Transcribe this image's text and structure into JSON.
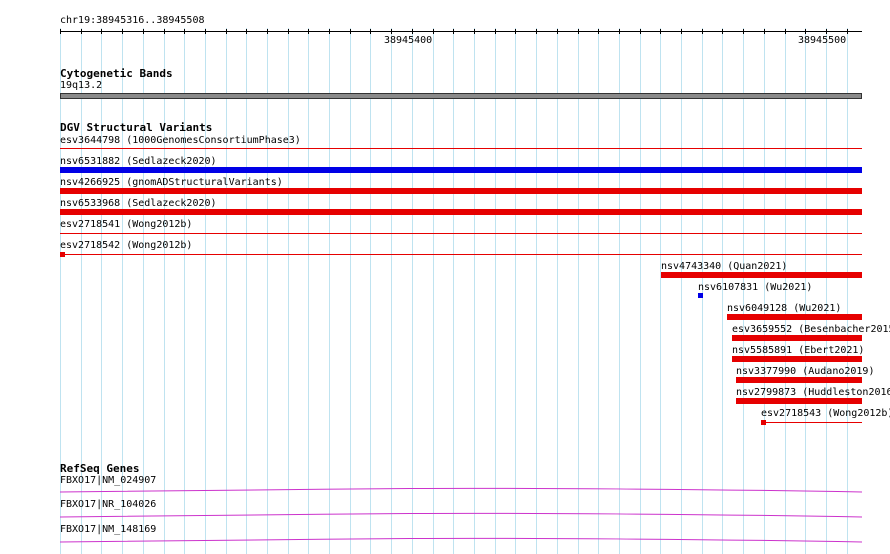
{
  "ruler": {
    "range_label": "chr19:38945316..38945508",
    "tick_left": "38945400",
    "tick_right": "38945500"
  },
  "cytobands": {
    "title": "Cytogenetic Bands",
    "band_label": "19q13.2"
  },
  "dgv": {
    "title": "DGV Structural Variants",
    "variants": [
      {
        "label": "esv3644798 (1000GenomesConsortiumPhase3)",
        "color": "#e60000",
        "style": "thin"
      },
      {
        "label": "nsv6531882 (Sedlazeck2020)",
        "color": "#0000e6",
        "style": "thick"
      },
      {
        "label": "nsv4266925 (gnomADStructuralVariants)",
        "color": "#e60000",
        "style": "thick"
      },
      {
        "label": "nsv6533968 (Sedlazeck2020)",
        "color": "#e60000",
        "style": "thick"
      },
      {
        "label": "esv2718541 (Wong2012b)",
        "color": "#e60000",
        "style": "thin"
      },
      {
        "label": "esv2718542 (Wong2012b)",
        "color": "#e60000",
        "style": "thin-marker"
      },
      {
        "label": "nsv4743340 (Quan2021)",
        "color": "#e60000",
        "style": "thick"
      },
      {
        "label": "nsv6107831 (Wu2021)",
        "color": "#0000e6",
        "style": "dot"
      },
      {
        "label": "nsv6049128 (Wu2021)",
        "color": "#e60000",
        "style": "thick"
      },
      {
        "label": "esv3659552 (Besenbacher2015)",
        "color": "#e60000",
        "style": "thick"
      },
      {
        "label": "nsv5585891 (Ebert2021)",
        "color": "#e60000",
        "style": "thick"
      },
      {
        "label": "nsv3377990 (Audano2019)",
        "color": "#e60000",
        "style": "thick"
      },
      {
        "label": "nsv2799873 (Huddleston2016)",
        "color": "#e60000",
        "style": "thick"
      },
      {
        "label": "esv2718543 (Wong2012b)",
        "color": "#e60000",
        "style": "thin-marker"
      }
    ]
  },
  "refseq": {
    "title": "RefSeq Genes",
    "color": "#cc33cc",
    "genes": [
      {
        "label": "FBXO17|NM_024907"
      },
      {
        "label": "FBXO17|NR_104026"
      },
      {
        "label": "FBXO17|NM_148169"
      }
    ]
  }
}
